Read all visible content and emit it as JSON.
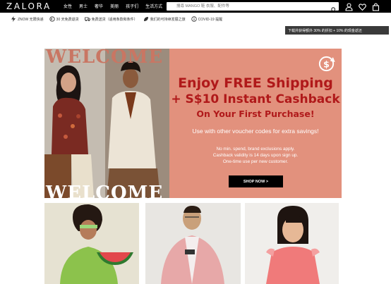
{
  "header": {
    "logo": "ZALORA",
    "nav": [
      "女性",
      "男士",
      "奢华",
      "美丽",
      "孩子们",
      "生活方式"
    ],
    "search_placeholder": "搜尋 MANGO 鞋 衣服、配件等"
  },
  "usp": {
    "items": [
      {
        "icon": "lightning-icon",
        "label": "ZNOW 无限快递"
      },
      {
        "icon": "return-icon",
        "label": "30 天免费退货"
      },
      {
        "icon": "truck-icon",
        "label": "免费送货（适用条款和条件）"
      },
      {
        "icon": "leaf-icon",
        "label": "我们的可持续发展之旅"
      },
      {
        "icon": "info-icon",
        "label": "COVID-19 提醒"
      }
    ],
    "promo": "下载并获得额外 30% 的折扣 + 10% 的现金返还"
  },
  "banner": {
    "welcome": "WELCOME",
    "headline_1": "Enjoy FREE Shipping",
    "headline_2": "+ S$10  Instant Cashback",
    "headline_3": "On Your First Purchase!",
    "subline": "Use with other voucher codes for extra savings!",
    "fine_1": "No min. spend, brand exclusions apply.",
    "fine_2": "Cashback validity is 14 days upon sign up.",
    "fine_3": "One-time use per new customer.",
    "cta": "SHOP NOW >",
    "accent": "#e2917d",
    "headline_color": "#b0191a"
  }
}
